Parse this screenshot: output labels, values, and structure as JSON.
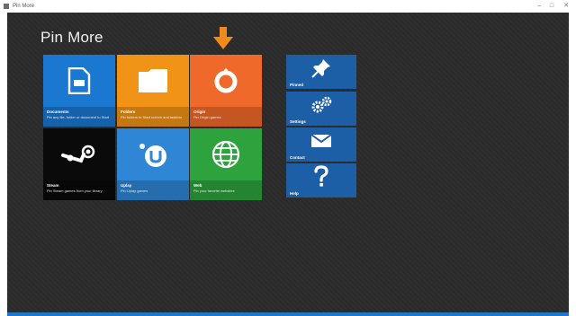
{
  "window": {
    "title": "Pin More",
    "controls": {
      "minimize": "–",
      "maximize": "□",
      "close": "✕"
    }
  },
  "page": {
    "title": "Pin More"
  },
  "colors": {
    "accent": "#1e78c8",
    "background": "#2b2b2b",
    "arrow": "#f08a1c"
  },
  "tiles": [
    {
      "title": "Documents",
      "description": "Pin any file, folder or document to Start",
      "color": "#1b78d0",
      "icon": "document-icon"
    },
    {
      "title": "Folders",
      "description": "Pin folders to Start screen and taskbar",
      "color": "#f09317",
      "icon": "folder-icon"
    },
    {
      "title": "Origin",
      "description": "Pin Origin games",
      "color": "#ef6a2a",
      "icon": "origin-icon"
    },
    {
      "title": "Steam",
      "description": "Pin Steam games from your library",
      "color": "#0a0a0a",
      "icon": "steam-icon"
    },
    {
      "title": "Uplay",
      "description": "Pin Uplay games",
      "color": "#2f86d4",
      "icon": "uplay-icon"
    },
    {
      "title": "Web",
      "description": "Pin your favorite websites",
      "color": "#2ea23c",
      "icon": "globe-icon"
    }
  ],
  "side_tiles": [
    {
      "label": "Pinned",
      "icon": "pin-icon"
    },
    {
      "label": "Settings",
      "icon": "gears-icon"
    },
    {
      "label": "Contact",
      "icon": "mail-icon"
    },
    {
      "label": "Help",
      "icon": "question-icon"
    }
  ]
}
